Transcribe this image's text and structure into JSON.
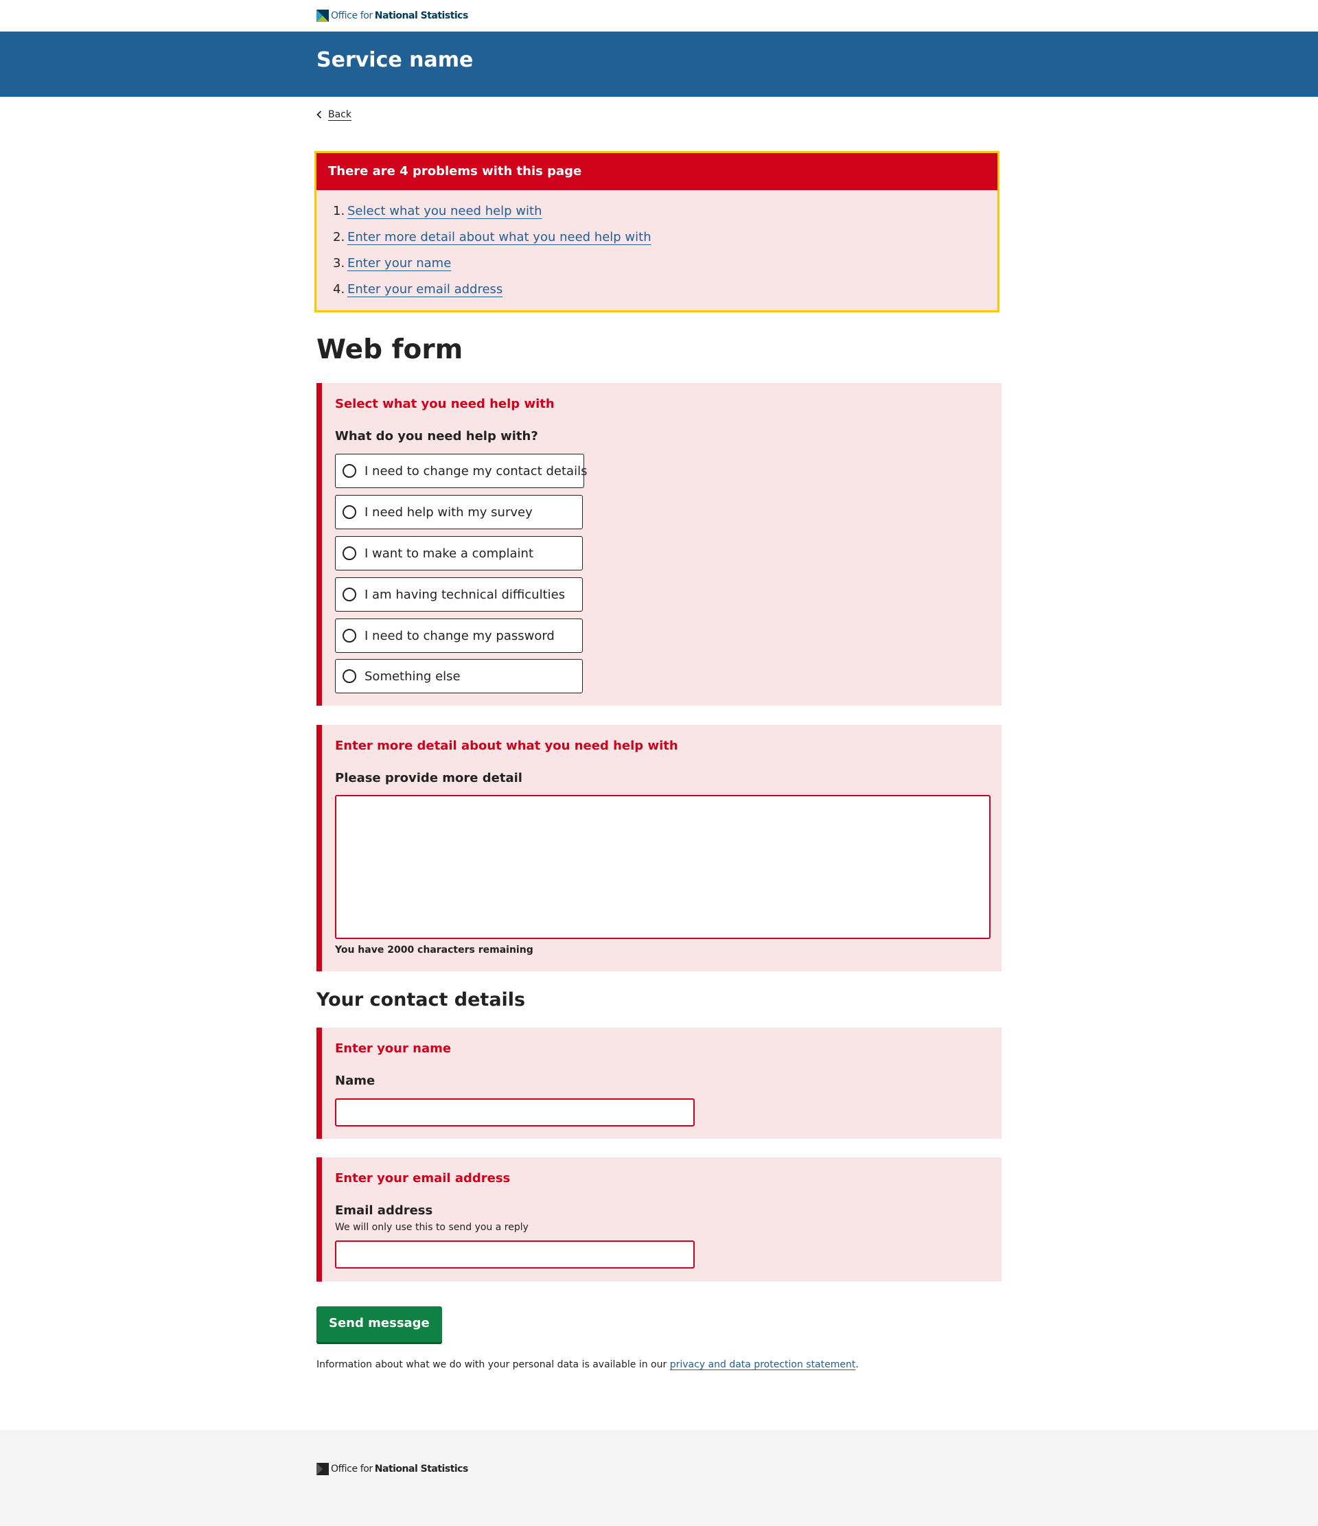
{
  "masthead": {
    "logo_office": "Office for",
    "logo_ons": "National Statistics"
  },
  "banner": {
    "service_name": "Service name"
  },
  "back": {
    "label": "Back"
  },
  "error_summary": {
    "title": "There are 4 problems with this page",
    "items": [
      {
        "num": "1.",
        "text": "Select what you need help with"
      },
      {
        "num": "2.",
        "text": "Enter more detail about what you need help with"
      },
      {
        "num": "3.",
        "text": "Enter your name"
      },
      {
        "num": "4.",
        "text": "Enter your email address"
      }
    ]
  },
  "page_title": "Web form",
  "help_panel": {
    "error": "Select what you need help with",
    "legend": "What do you need help with?",
    "options": [
      "I need to change my contact details",
      "I need help with my survey",
      "I want to make a complaint",
      "I am having technical difficulties",
      "I need to change my password",
      "Something else"
    ]
  },
  "detail_panel": {
    "error": "Enter more detail about what you need help with",
    "label": "Please provide more detail",
    "counter": "You have 2000 characters remaining"
  },
  "contact_heading": "Your contact details",
  "name_panel": {
    "error": "Enter your name",
    "label": "Name"
  },
  "email_panel": {
    "error": "Enter your email address",
    "label": "Email address",
    "hint": "We will only use this to send you a reply"
  },
  "submit": {
    "label": "Send message"
  },
  "privacy": {
    "prefix": "Information about what we do with your personal data is available in our ",
    "link": "privacy and data protection statement",
    "suffix": "."
  },
  "footer": {
    "logo_office": "Office for",
    "logo_ons": "National Statistics"
  },
  "colors": {
    "brand_blue": "#206095",
    "error_red": "#d0021b",
    "error_bg": "#f9e4e6",
    "focus_yellow": "#fbc900",
    "button_green": "#0f8243"
  }
}
